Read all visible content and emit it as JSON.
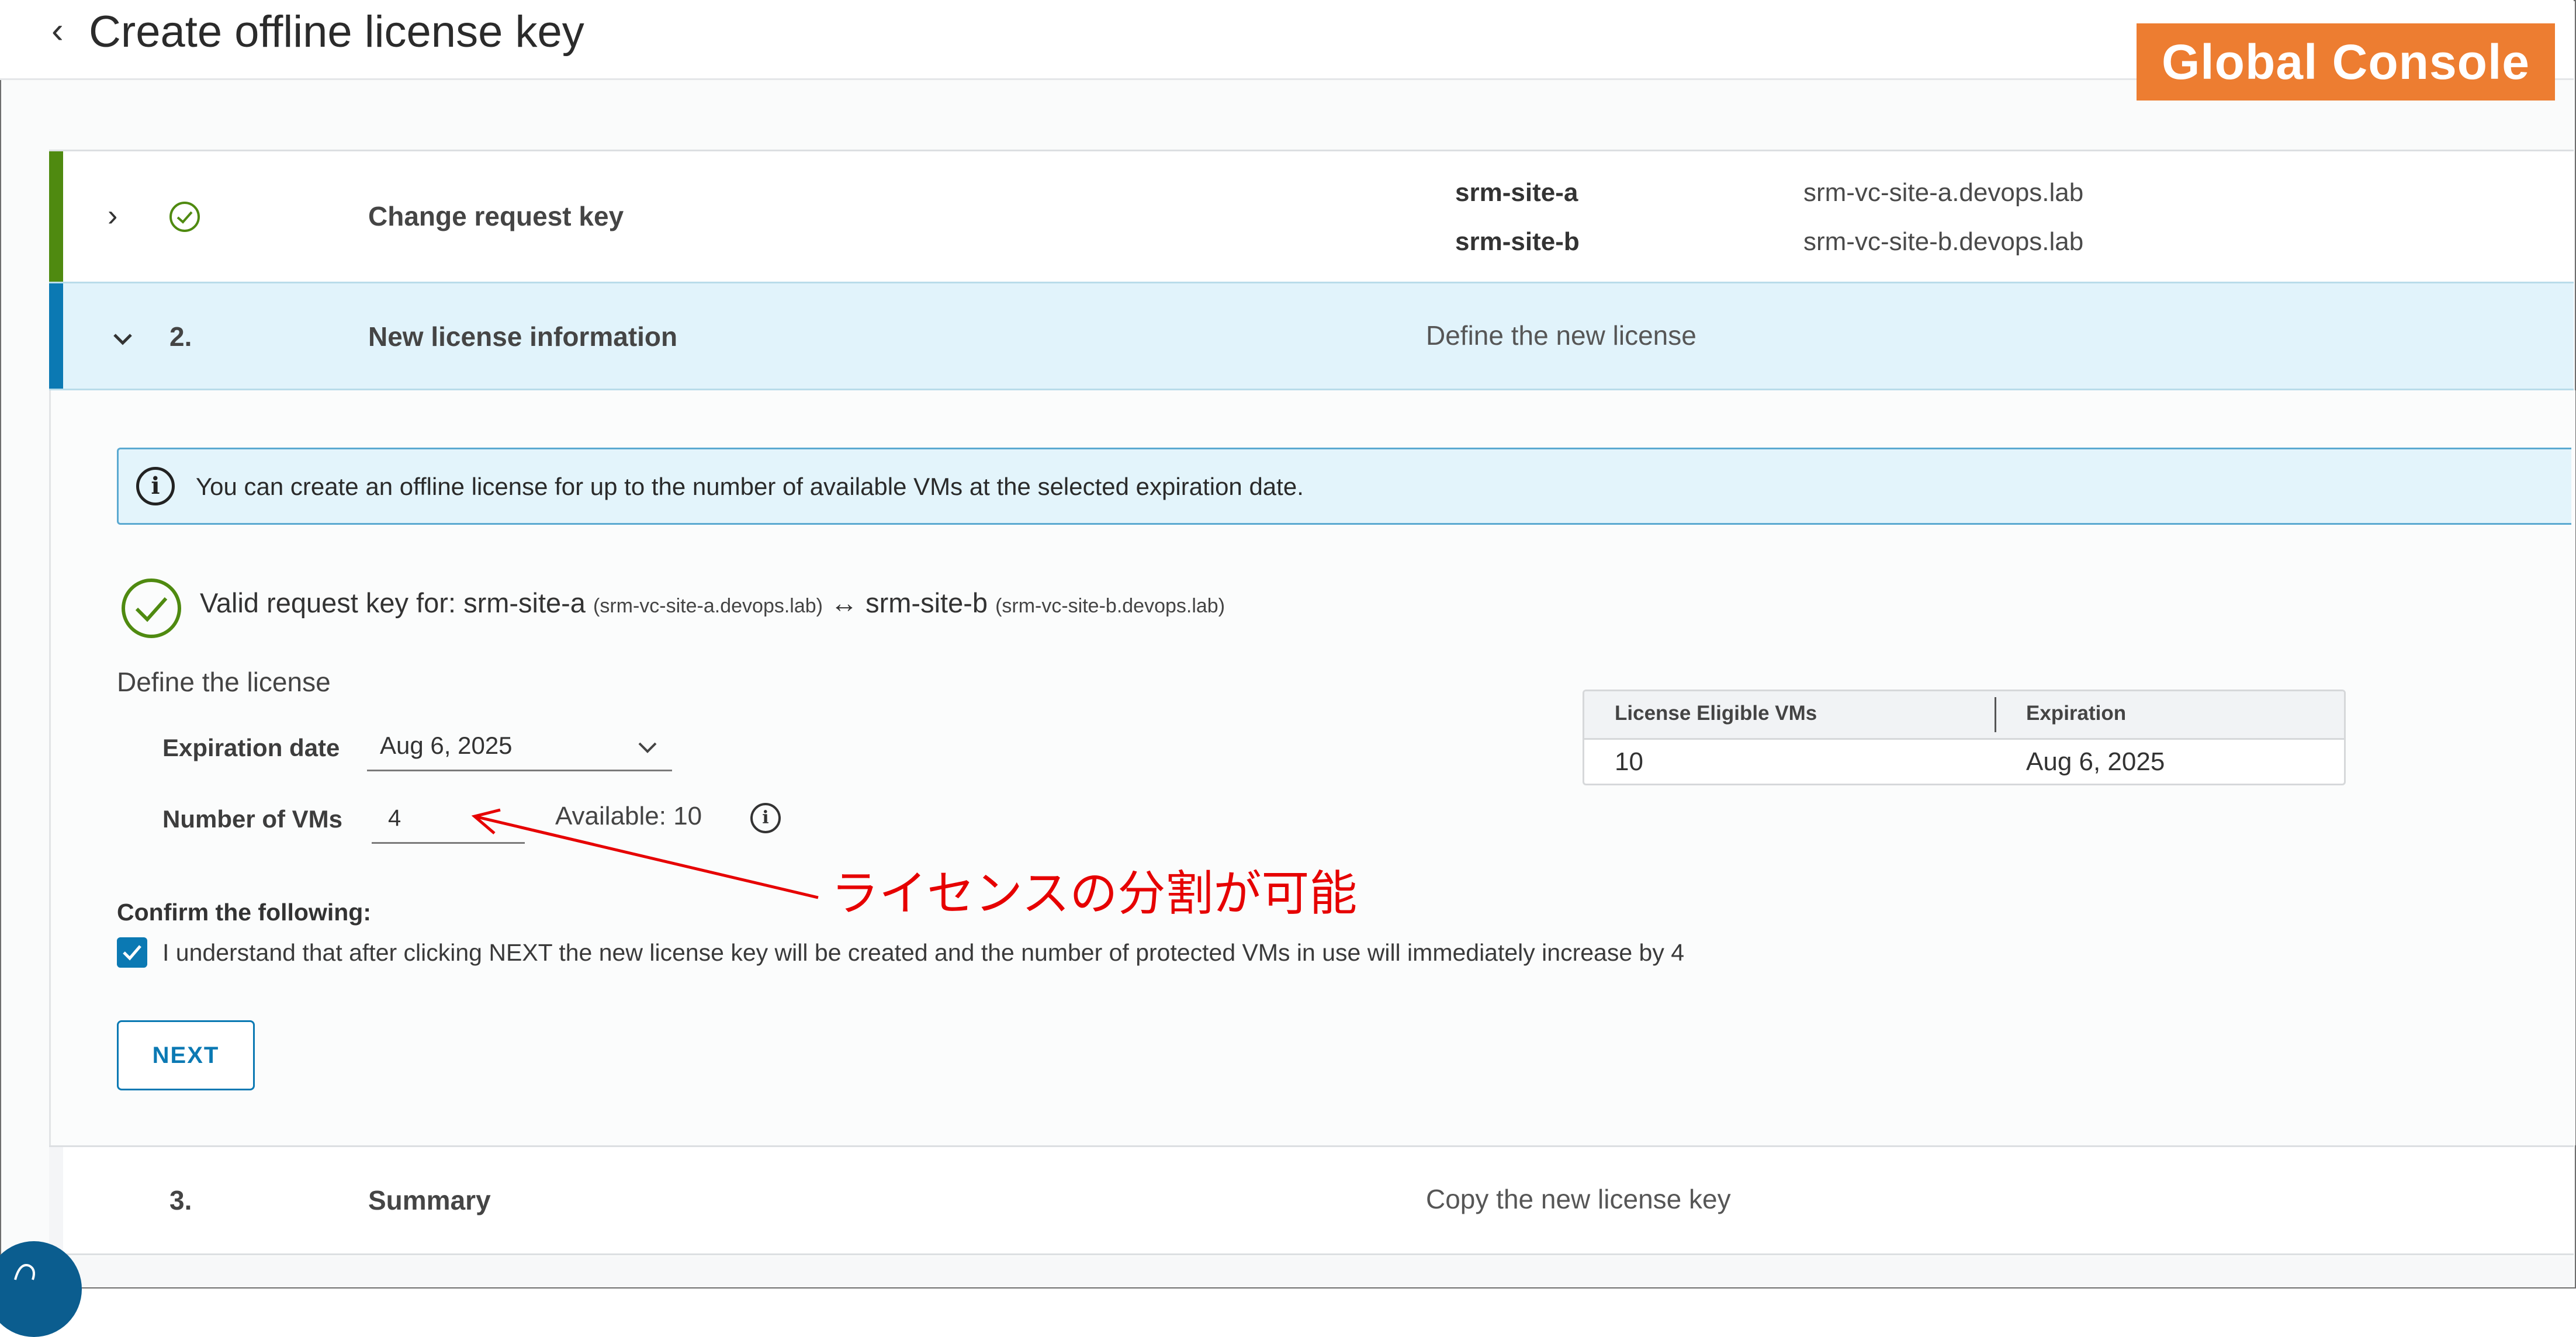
{
  "header": {
    "back_icon": "chevron-left-icon",
    "title": "Create offline license key",
    "badge": "Global Console",
    "badge_color": "#ed7d31"
  },
  "steps": [
    {
      "status_icon": "check-circle-icon",
      "title": "Change request key",
      "sites": [
        {
          "name": "srm-site-a",
          "host": "srm-vc-site-a.devops.lab"
        },
        {
          "name": "srm-site-b",
          "host": "srm-vc-site-b.devops.lab"
        }
      ]
    },
    {
      "number": "2.",
      "title": "New license information",
      "description": "Define the new license"
    },
    {
      "number": "3.",
      "title": "Summary",
      "description": "Copy the new license key"
    }
  ],
  "info_banner": {
    "text": "You can create an offline license for up to the number of available VMs at the selected expiration date."
  },
  "valid_key": {
    "prefix": "Valid request key for: srm-site-a",
    "site_a_host": "(srm-vc-site-a.devops.lab)",
    "connector": " ↔ srm-site-b ",
    "site_b_host": "(srm-vc-site-b.devops.lab)"
  },
  "form": {
    "section_title": "Define the license",
    "expiration_label": "Expiration date",
    "expiration_value": "Aug 6, 2025",
    "vms_label": "Number of VMs",
    "vms_value": "4",
    "available": "Available: 10"
  },
  "table": {
    "headers": [
      "License Eligible VMs",
      "Expiration"
    ],
    "rows": [
      [
        "10",
        "Aug 6, 2025"
      ]
    ]
  },
  "annotation": {
    "text": "ライセンスの分割が可能",
    "color": "#e60000"
  },
  "confirm": {
    "heading": "Confirm the following:",
    "checked": true,
    "text": "I understand that after clicking NEXT the new license key will be created and the number of protected VMs in use will immediately increase by 4"
  },
  "next_label": "NEXT",
  "colors": {
    "accent": "#0b79b3",
    "success": "#4f8a10",
    "active_row": "#e1f3fb"
  }
}
